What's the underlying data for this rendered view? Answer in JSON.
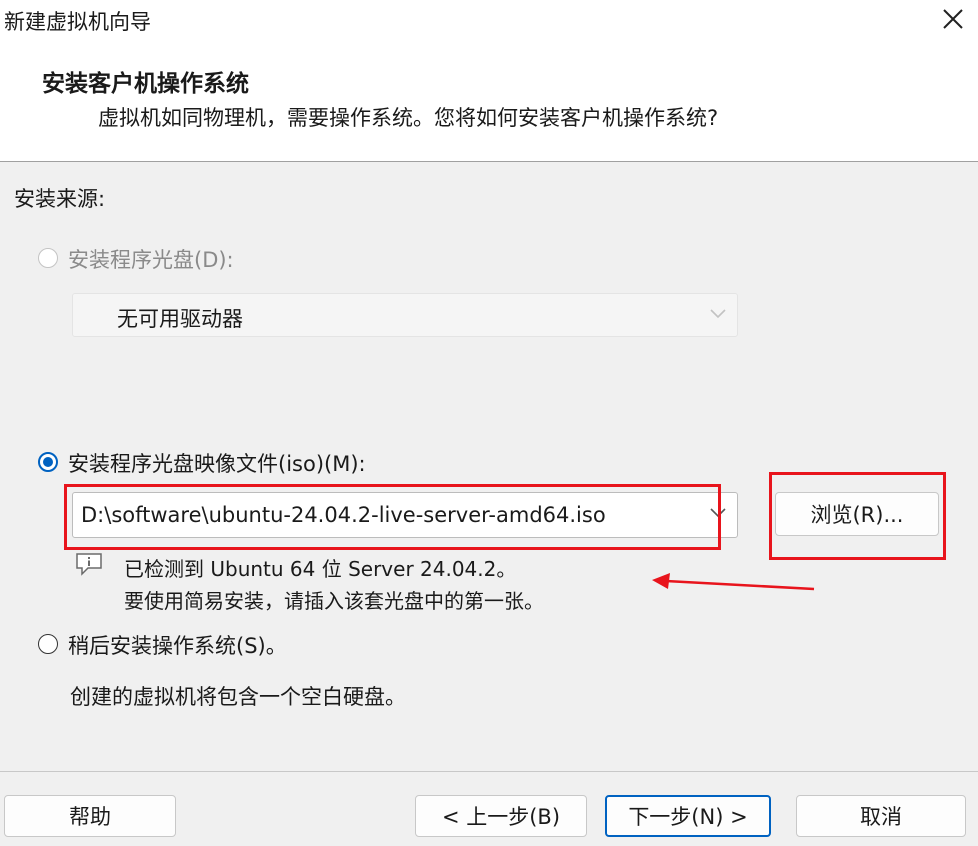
{
  "window": {
    "title": "新建虚拟机向导",
    "close_glyph": "✕"
  },
  "header": {
    "title": "安装客户机操作系统",
    "subtitle": "虚拟机如同物理机，需要操作系统。您将如何安装客户机操作系统?"
  },
  "install_source": {
    "label": "安装来源:",
    "options": [
      {
        "label": "安装程序光盘(D):",
        "selected": false,
        "enabled": false
      },
      {
        "label": "安装程序光盘映像文件(iso)(M):",
        "selected": true,
        "enabled": true
      },
      {
        "label": "稍后安装操作系统(S)。",
        "selected": false,
        "enabled": true
      }
    ],
    "drive_select": {
      "value": "无可用驱动器",
      "enabled": false
    },
    "iso_path": {
      "value": "D:\\software\\ubuntu-24.04.2-live-server-amd64.iso"
    },
    "browse_button": "浏览(R)...",
    "detect_info": {
      "icon": "info-icon",
      "line1": "已检测到 Ubuntu 64 位 Server 24.04.2。",
      "line2": "要使用简易安装，请插入该套光盘中的第一张。"
    },
    "later_description": "创建的虚拟机将包含一个空白硬盘。"
  },
  "footer": {
    "help": "帮助",
    "back": "< 上一步(B)",
    "next": "下一步(N) >",
    "cancel": "取消"
  },
  "annotation_color": "#e8141c"
}
